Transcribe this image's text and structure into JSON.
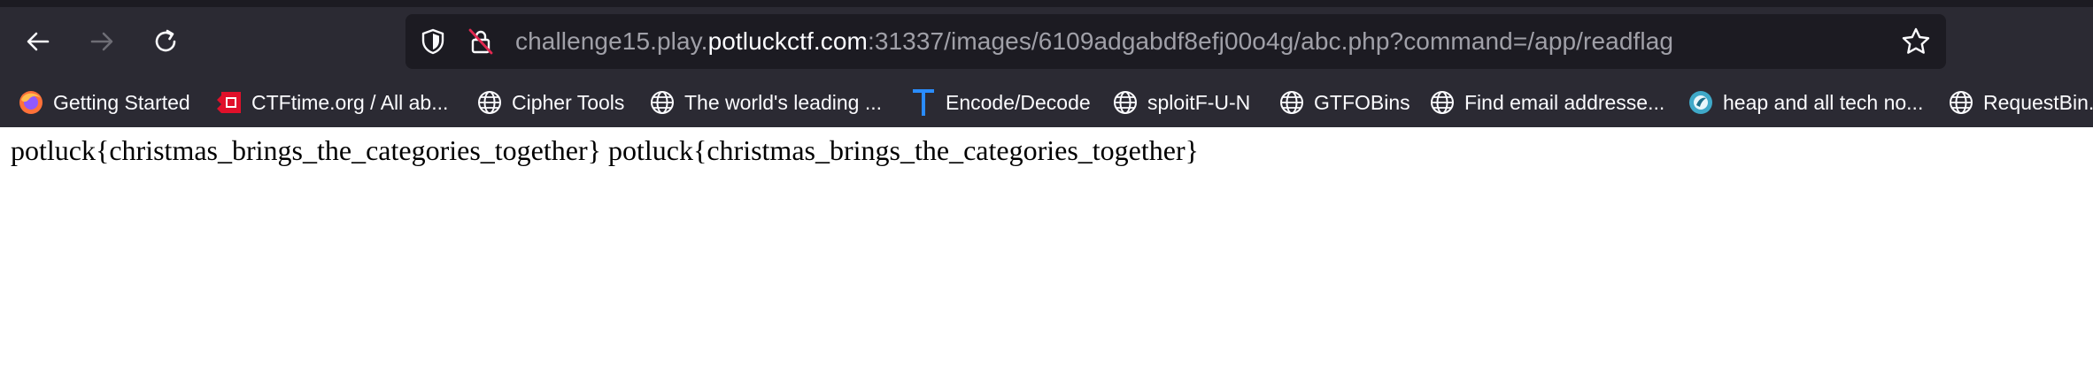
{
  "browser": {
    "address_bar": {
      "url_prefix": "challenge15.play.",
      "url_domain": "potluckctf.com",
      "url_suffix": ":31337/images/6109adgabdf8efj00o4g/abc.php?command=/app/readflag"
    },
    "bookmarks": [
      {
        "label": "Getting Started",
        "icon": "firefox-icon"
      },
      {
        "label": "CTFtime.org / All ab...",
        "icon": "ctftime-icon"
      },
      {
        "label": "Cipher Tools",
        "icon": "globe-icon"
      },
      {
        "label": "The world's leading ...",
        "icon": "globe-icon"
      },
      {
        "label": "Encode/Decode",
        "icon": "t-icon"
      },
      {
        "label": "sploitF-U-N",
        "icon": "globe-icon"
      },
      {
        "label": "GTFOBins",
        "icon": "globe-icon"
      },
      {
        "label": "Find email addresse...",
        "icon": "globe-icon"
      },
      {
        "label": "heap and all tech no...",
        "icon": "blog-icon"
      },
      {
        "label": "RequestBin.",
        "icon": "globe-icon"
      }
    ]
  },
  "page": {
    "body_text": "potluck{christmas_brings_the_categories_together} potluck{christmas_brings_the_categories_together}"
  },
  "colors": {
    "chrome_bg": "#2b2a33",
    "urlbar_bg": "#1c1b22",
    "text_light": "#fbfbfe",
    "text_muted": "#a0a0a8"
  }
}
